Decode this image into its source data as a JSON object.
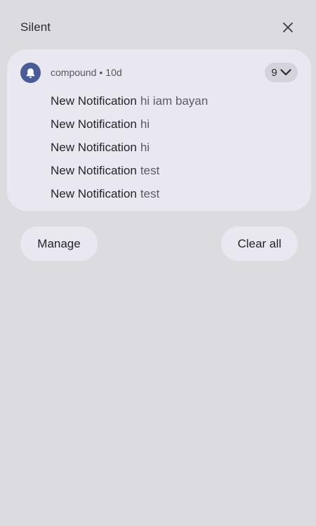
{
  "section": {
    "title": "Silent",
    "close_icon": "close-icon"
  },
  "notification_group": {
    "app_icon": "bell-icon",
    "app_name": "compound",
    "separator": "•",
    "age": "10d",
    "count": "9",
    "expand_icon": "chevron-down-icon",
    "accent_color": "#4a5b96",
    "items": [
      {
        "title": "New Notification",
        "message": "hi iam bayan"
      },
      {
        "title": "New Notification",
        "message": "hi"
      },
      {
        "title": "New Notification",
        "message": "hi"
      },
      {
        "title": "New Notification",
        "message": "test"
      },
      {
        "title": "New Notification",
        "message": "test"
      }
    ]
  },
  "actions": {
    "manage_label": "Manage",
    "clear_all_label": "Clear all"
  }
}
